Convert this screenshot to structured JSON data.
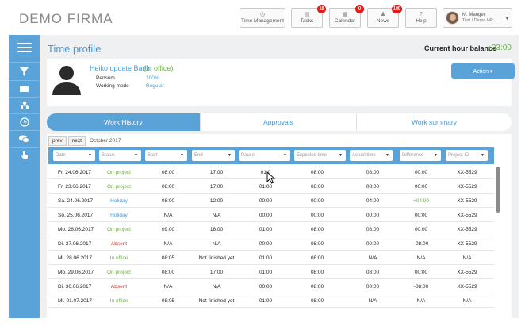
{
  "brand": "DEMO FIRMA",
  "nav": [
    {
      "label": "Time Management",
      "icon": "clock-icon",
      "badge": ""
    },
    {
      "label": "Tasks",
      "icon": "tasks-icon",
      "badge": "18"
    },
    {
      "label": "Calendar",
      "icon": "calendar-icon",
      "badge": "0"
    },
    {
      "label": "News",
      "icon": "bell-icon",
      "badge": "100"
    },
    {
      "label": "Help",
      "icon": "help-icon",
      "badge": ""
    }
  ],
  "user": {
    "name": "M. Manger",
    "company": "Test / Demo HR..."
  },
  "page": {
    "title": "Time profile",
    "balance_label": "Current hour balance",
    "balance_value": "+33:00"
  },
  "profile": {
    "name": "Heiko update Barth",
    "status": "(In office)",
    "pensum_label": "Pensum",
    "pensum_value": "100%",
    "working_mode_label": "Working mode",
    "working_mode_value": "Regular",
    "action_label": "Action ▾"
  },
  "tabs": [
    "Work History",
    "Approvals",
    "Work summary"
  ],
  "pager": {
    "prev": "prev",
    "next": "next",
    "month": "October 2017"
  },
  "filters": [
    "Date",
    "Status",
    "Start",
    "End",
    "Pause",
    "Expected time",
    "Actual time",
    "Difference",
    "Project ID"
  ],
  "rows": [
    {
      "date": "Fr. 24.06.2017",
      "status": "On project",
      "start": "08:00",
      "end": "17:00",
      "pause": "01:0",
      "expected": "08:00",
      "actual": "08:00",
      "difference": "00:00",
      "project": "XX-5529"
    },
    {
      "date": "Fr. 23.06.2017",
      "status": "On project",
      "start": "08:00",
      "end": "17:00",
      "pause": "01:00",
      "expected": "08:00",
      "actual": "08:00",
      "difference": "00:00",
      "project": "XX-5529"
    },
    {
      "date": "Sa. 24.06.2017",
      "status": "Holiday",
      "start": "08:00",
      "end": "12:00",
      "pause": "00:00",
      "expected": "00:00",
      "actual": "04:00",
      "difference": "+04:00",
      "project": "XX-5529"
    },
    {
      "date": "So. 25.06.2017",
      "status": "Holiday",
      "start": "N/A",
      "end": "N/A",
      "pause": "00:00",
      "expected": "00:00",
      "actual": "00:00",
      "difference": "00:00",
      "project": "XX-5529"
    },
    {
      "date": "Mo. 26.06.2017",
      "status": "On project",
      "start": "09:00",
      "end": "18:00",
      "pause": "01:00",
      "expected": "08:00",
      "actual": "08:00",
      "difference": "00:00",
      "project": "XX-5529"
    },
    {
      "date": "Di. 27.06.2017",
      "status": "Absent",
      "start": "N/A",
      "end": "N/A",
      "pause": "00:00",
      "expected": "08:00",
      "actual": "00:00",
      "difference": "-08:00",
      "project": "XX-5529"
    },
    {
      "date": "Mi. 28.06.2017",
      "status": "In office",
      "start": "08:05",
      "end": "Not finished yet",
      "pause": "01:00",
      "expected": "08:00",
      "actual": "N/A",
      "difference": "N/A",
      "project": "N/A"
    },
    {
      "date": "Mo. 29.06.2017",
      "status": "On project",
      "start": "08:00",
      "end": "17:00",
      "pause": "01:00",
      "expected": "08:00",
      "actual": "08:00",
      "difference": "00:00",
      "project": "XX-5529"
    },
    {
      "date": "Di. 30.06.2017",
      "status": "Absent",
      "start": "N/A",
      "end": "N/A",
      "pause": "00:00",
      "expected": "08:00",
      "actual": "00:00",
      "difference": "-08:00",
      "project": "XX-5529"
    },
    {
      "date": "Mi. 01.07.2017",
      "status": "In office",
      "start": "08:05",
      "end": "Not finished yet",
      "pause": "01:00",
      "expected": "08:00",
      "actual": "N/A",
      "difference": "N/A",
      "project": "N/A"
    }
  ],
  "colors": {
    "accent": "#5aa3d8",
    "positive": "#6fb04b",
    "negative": "#d9342b",
    "badge": "#e21b1b"
  }
}
